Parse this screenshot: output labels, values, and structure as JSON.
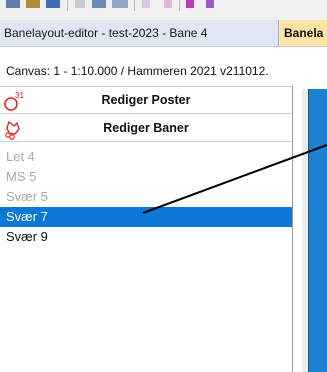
{
  "toolbar": {
    "icons": [
      "toolbar-icon",
      "toolbar-icon",
      "toolbar-icon",
      "toolbar-icon",
      "toolbar-icon",
      "toolbar-icon",
      "toolbar-icon",
      "toolbar-icon"
    ]
  },
  "tabs": [
    {
      "label": "Banelayout-editor - test-2023 - Bane 4"
    },
    {
      "label": "Banela"
    }
  ],
  "canvas_info": {
    "text": "Canvas:  1 - 1:10.000 / Hammeren 2021 v211012."
  },
  "panel": {
    "edit_posts": {
      "label": "Rediger Poster",
      "icon": "control-circle-icon",
      "badge": "31"
    },
    "edit_courses": {
      "label": "Rediger Baner",
      "icon": "course-loop-icon"
    },
    "courses": [
      {
        "label": "Let 4",
        "state": "disabled"
      },
      {
        "label": "MS 5",
        "state": "disabled"
      },
      {
        "label": "Svær 5",
        "state": "disabled"
      },
      {
        "label": "Svær 7",
        "state": "selected"
      },
      {
        "label": "Svær 9",
        "state": "normal"
      }
    ]
  },
  "colors": {
    "selected_bg": "#0a78d4",
    "active_tab_bg": "#fbe4a6",
    "title_tab_bg": "#dfe7f3",
    "map_blue": "#1f7fd0",
    "control_red": "#e02020"
  }
}
